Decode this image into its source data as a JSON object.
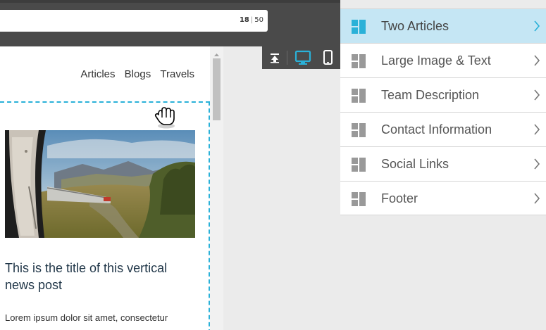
{
  "subject_field": {
    "char_count": "18",
    "char_limit": "50"
  },
  "view_toggle": {
    "items": [
      "collapse-icon",
      "desktop-icon",
      "mobile-icon"
    ],
    "active": "desktop"
  },
  "preview": {
    "nav": [
      "Articles",
      "Blogs",
      "Travels"
    ],
    "post_title": "This is the title of this vertical news post",
    "post_excerpt": "Lorem ipsum dolor sit amet, consectetur"
  },
  "blocks": {
    "items": [
      {
        "label": "Two Articles",
        "active": true
      },
      {
        "label": "Large Image & Text",
        "active": false
      },
      {
        "label": "Team Description",
        "active": false
      },
      {
        "label": "Contact Information",
        "active": false
      },
      {
        "label": "Social Links",
        "active": false
      },
      {
        "label": "Footer",
        "active": false
      }
    ]
  },
  "colors": {
    "accent": "#2ab1d8",
    "active_row": "#c5e6f4",
    "toolbar": "#4a4a4a",
    "icon_grey": "#999999"
  }
}
